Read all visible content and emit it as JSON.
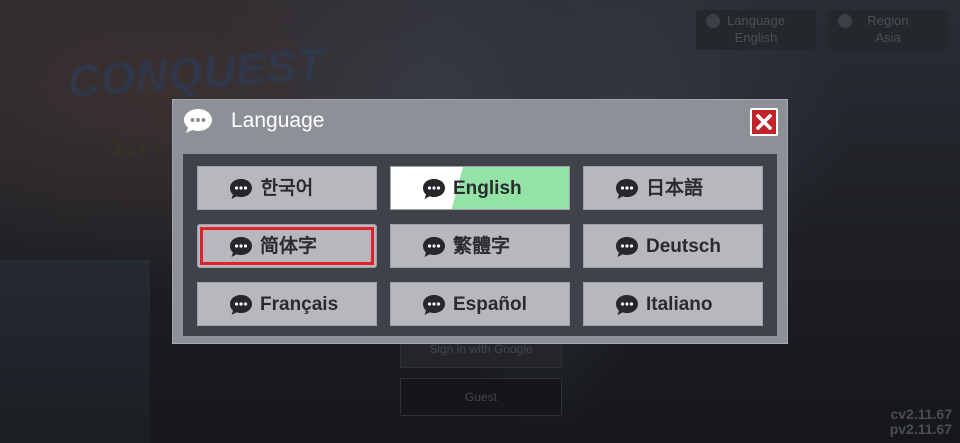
{
  "background": {
    "top_buttons": [
      {
        "label": "Language",
        "value": "English"
      },
      {
        "label": "Region",
        "value": "Asia"
      }
    ],
    "google_button": "Sign in with Google",
    "guest_button": "Guest",
    "versions": [
      "cv2.11.67",
      "pv2.11.67"
    ]
  },
  "dialog": {
    "title": "Language",
    "languages": [
      {
        "label": "한국어",
        "selected": false,
        "highlighted": false
      },
      {
        "label": "English",
        "selected": true,
        "highlighted": false
      },
      {
        "label": "日本語",
        "selected": false,
        "highlighted": false
      },
      {
        "label": "简体字",
        "selected": false,
        "highlighted": true
      },
      {
        "label": "繁體字",
        "selected": false,
        "highlighted": false
      },
      {
        "label": "Deutsch",
        "selected": false,
        "highlighted": false
      },
      {
        "label": "Français",
        "selected": false,
        "highlighted": false
      },
      {
        "label": "Español",
        "selected": false,
        "highlighted": false
      },
      {
        "label": "Italiano",
        "selected": false,
        "highlighted": false
      }
    ]
  },
  "colors": {
    "selected_accent": "#93e2a6",
    "close_button": "#c3222a",
    "highlight_outline": "#e2222a"
  },
  "icons": {
    "language_option": "chat-bubble-icon",
    "close": "close-icon",
    "header": "chat-bubble-icon"
  }
}
